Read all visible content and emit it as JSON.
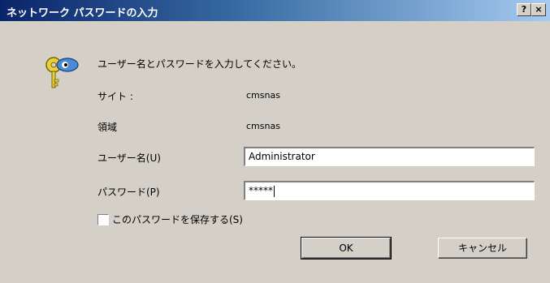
{
  "window": {
    "title": "ネットワーク パスワードの入力",
    "help_label": "?",
    "close_label": "×"
  },
  "dialog": {
    "instruction": "ユーザー名とパスワードを入力してください。",
    "site_label": "サイト :",
    "site_value": "cmsnas",
    "domain_label": "領域",
    "domain_value": "cmsnas",
    "username_label": "ユーザー名(U)",
    "username_value": "Administrator",
    "password_label": "パスワード(P)",
    "password_value": "*****",
    "save_password_label": "このパスワードを保存する(S)",
    "save_password_checked": false,
    "ok_label": "OK",
    "cancel_label": "キャンセル"
  },
  "icons": {
    "dialog_icon": "keys-icon"
  }
}
